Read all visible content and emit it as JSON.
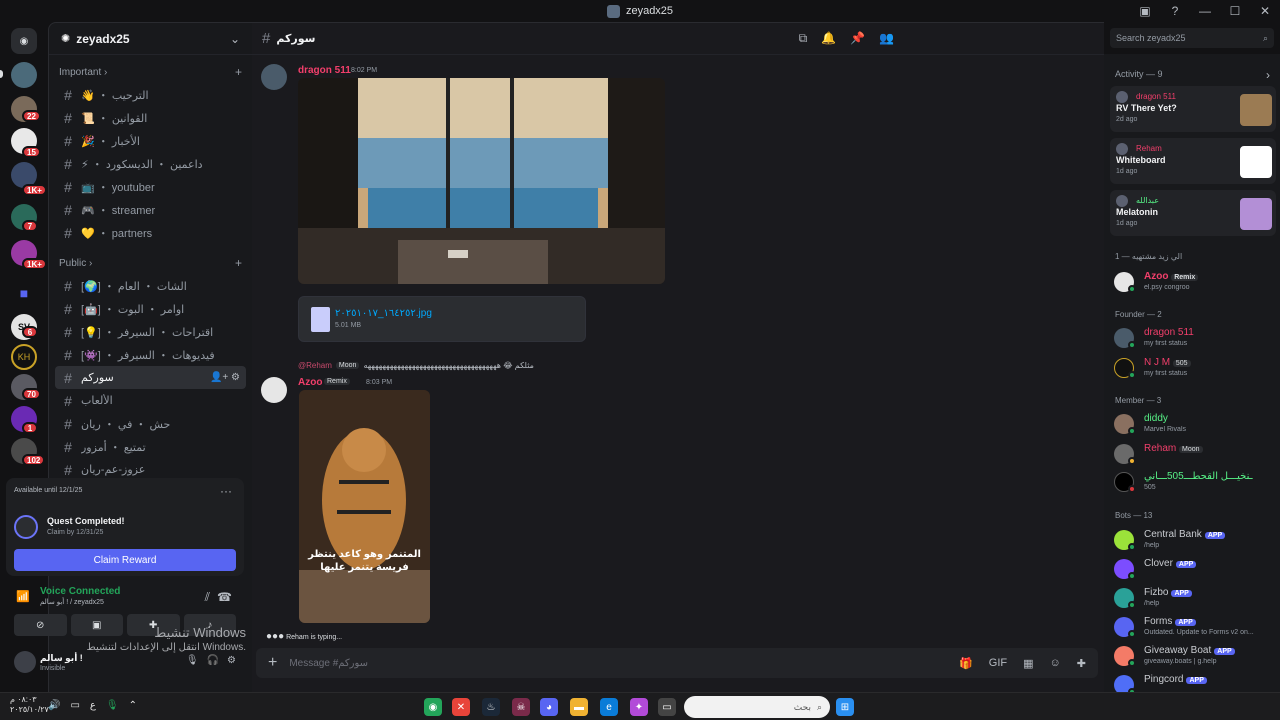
{
  "window": {
    "title": "zeyadx25"
  },
  "server": {
    "name": "zeyadx25"
  },
  "categories": {
    "important": "Important",
    "public": "Public"
  },
  "important_channels": [
    {
      "label": "👋 ・ الترحيب"
    },
    {
      "label": "📜 ・ القوانين"
    },
    {
      "label": "🎉 ・ الأخبار"
    },
    {
      "label": "⚡ ・ داعمين ・ الديسكورد"
    },
    {
      "label": "📺 ・ youtuber"
    },
    {
      "label": "🎮 ・ streamer"
    },
    {
      "label": "💛 ・ partners"
    }
  ],
  "public_channels": [
    {
      "label": "[🌍] ・ الشات ・ العام"
    },
    {
      "label": "[🤖] ・ اوامر ・ البوت"
    },
    {
      "label": "[💡] ・ اقتراحات ・ السيرفر"
    },
    {
      "label": "[👾] ・ فيديوهات ・ السيرفر"
    },
    {
      "label": "سوركم"
    },
    {
      "label": "الألعاب"
    },
    {
      "label": "حش ・ في ・ ريان"
    },
    {
      "label": "تمتيع ・ أمزور"
    },
    {
      "label": "عزوز-عم-ريان"
    }
  ],
  "server_badges": [
    "22",
    "15",
    "1K+",
    "7",
    "1K+",
    "6",
    "70",
    "1",
    "102"
  ],
  "quest": {
    "available": "Available until 12/1/25",
    "title": "Quest Completed!",
    "sub": "Claim by 12/31/25",
    "button": "Claim Reward"
  },
  "voice": {
    "status": "Voice Connected",
    "location": "أبو سالم ! / zeyadx25"
  },
  "user": {
    "name": "أبو سالم !",
    "status": "Invisible"
  },
  "watermark": {
    "line1": "تنشيط Windows",
    "line2": "انتقل إلى الإعدادات لتنشيط Windows."
  },
  "channel": {
    "name": "سوركم"
  },
  "search_placeholder": "Search zeyadx25",
  "messages": {
    "m1": {
      "author": "dragon 511",
      "time": "8:02 PM"
    },
    "file": {
      "name": "١٦٤٢٥٢_٢٠٢٥١٠١٧.jpg",
      "size": "5.01 MB"
    },
    "reply": {
      "author": "@Reham",
      "tag": "Moon",
      "text": "مثلكم 😂 ههههههههههههههههههههههههههههههههههههه"
    },
    "m2": {
      "author": "Azoo",
      "tag": "Remix",
      "time": "8:03 PM"
    },
    "video_caption": "المتنمر وهو كاعد ينتظر فريسة يتنمر عليها",
    "typing": "Reham is typing..."
  },
  "composer_placeholder": "Message #سوركم",
  "activity": {
    "header": "Activity — 9",
    "cards": [
      {
        "name": "dragon 511",
        "title": "RV There Yet?",
        "ago": "2d ago",
        "thumb": "#9b7b53"
      },
      {
        "name": "Reham",
        "title": "Whiteboard",
        "ago": "1d ago",
        "thumb": "#ffffff"
      },
      {
        "name": "عبدالله",
        "title": "Melatonin",
        "ago": "1d ago",
        "thumb": "#b38fd6"
      }
    ]
  },
  "member_groups": {
    "g0": "الي زيد مشتهيه — 1",
    "g1": "Founder — 2",
    "g2": "Member — 3",
    "g3": "Bots — 13"
  },
  "members": {
    "azoo": {
      "name": "Azoo",
      "tag": "Remix",
      "status": "el.psy congroo"
    },
    "dragon": {
      "name": "dragon 511",
      "status": "my first status"
    },
    "njm": {
      "name": "N J M",
      "tag": "505",
      "status": "my first status"
    },
    "diddy": {
      "name": "diddy",
      "status": "Marvel Rivals"
    },
    "reham": {
      "name": "Reham",
      "tag": "Moon"
    },
    "dbl": {
      "name": "ـنخيـــل القحطـــ505ـــاني",
      "status": "505"
    }
  },
  "bots": [
    {
      "name": "Central Bank",
      "badge": "APP",
      "status": "/help",
      "color": "#9be23a"
    },
    {
      "name": "Clover",
      "badge": "APP",
      "status": "",
      "color": "#7c4dff"
    },
    {
      "name": "Fizbo",
      "badge": "APP",
      "status": "/help",
      "color": "#2aa198"
    },
    {
      "name": "Forms",
      "badge": "APP",
      "status": "Outdated. Update to Forms v2 on...",
      "color": "#5865f2"
    },
    {
      "name": "Giveaway Boat",
      "badge": "APP",
      "status": "giveaway.boats | g.help",
      "color": "#f47b67"
    },
    {
      "name": "Pingcord",
      "badge": "APP",
      "status": "",
      "color": "#4f6ef7"
    }
  ],
  "taskbar": {
    "time": "٠٨:٠٣ م",
    "date": "٢٠٢٥/١٠/٢٧",
    "search": "بحث",
    "lang": "ع"
  },
  "colors": {
    "accent": "#5865f2",
    "online": "#23a55a",
    "dnd": "#da373c",
    "red_name": "#f23f6b",
    "green_name": "#57f287"
  }
}
